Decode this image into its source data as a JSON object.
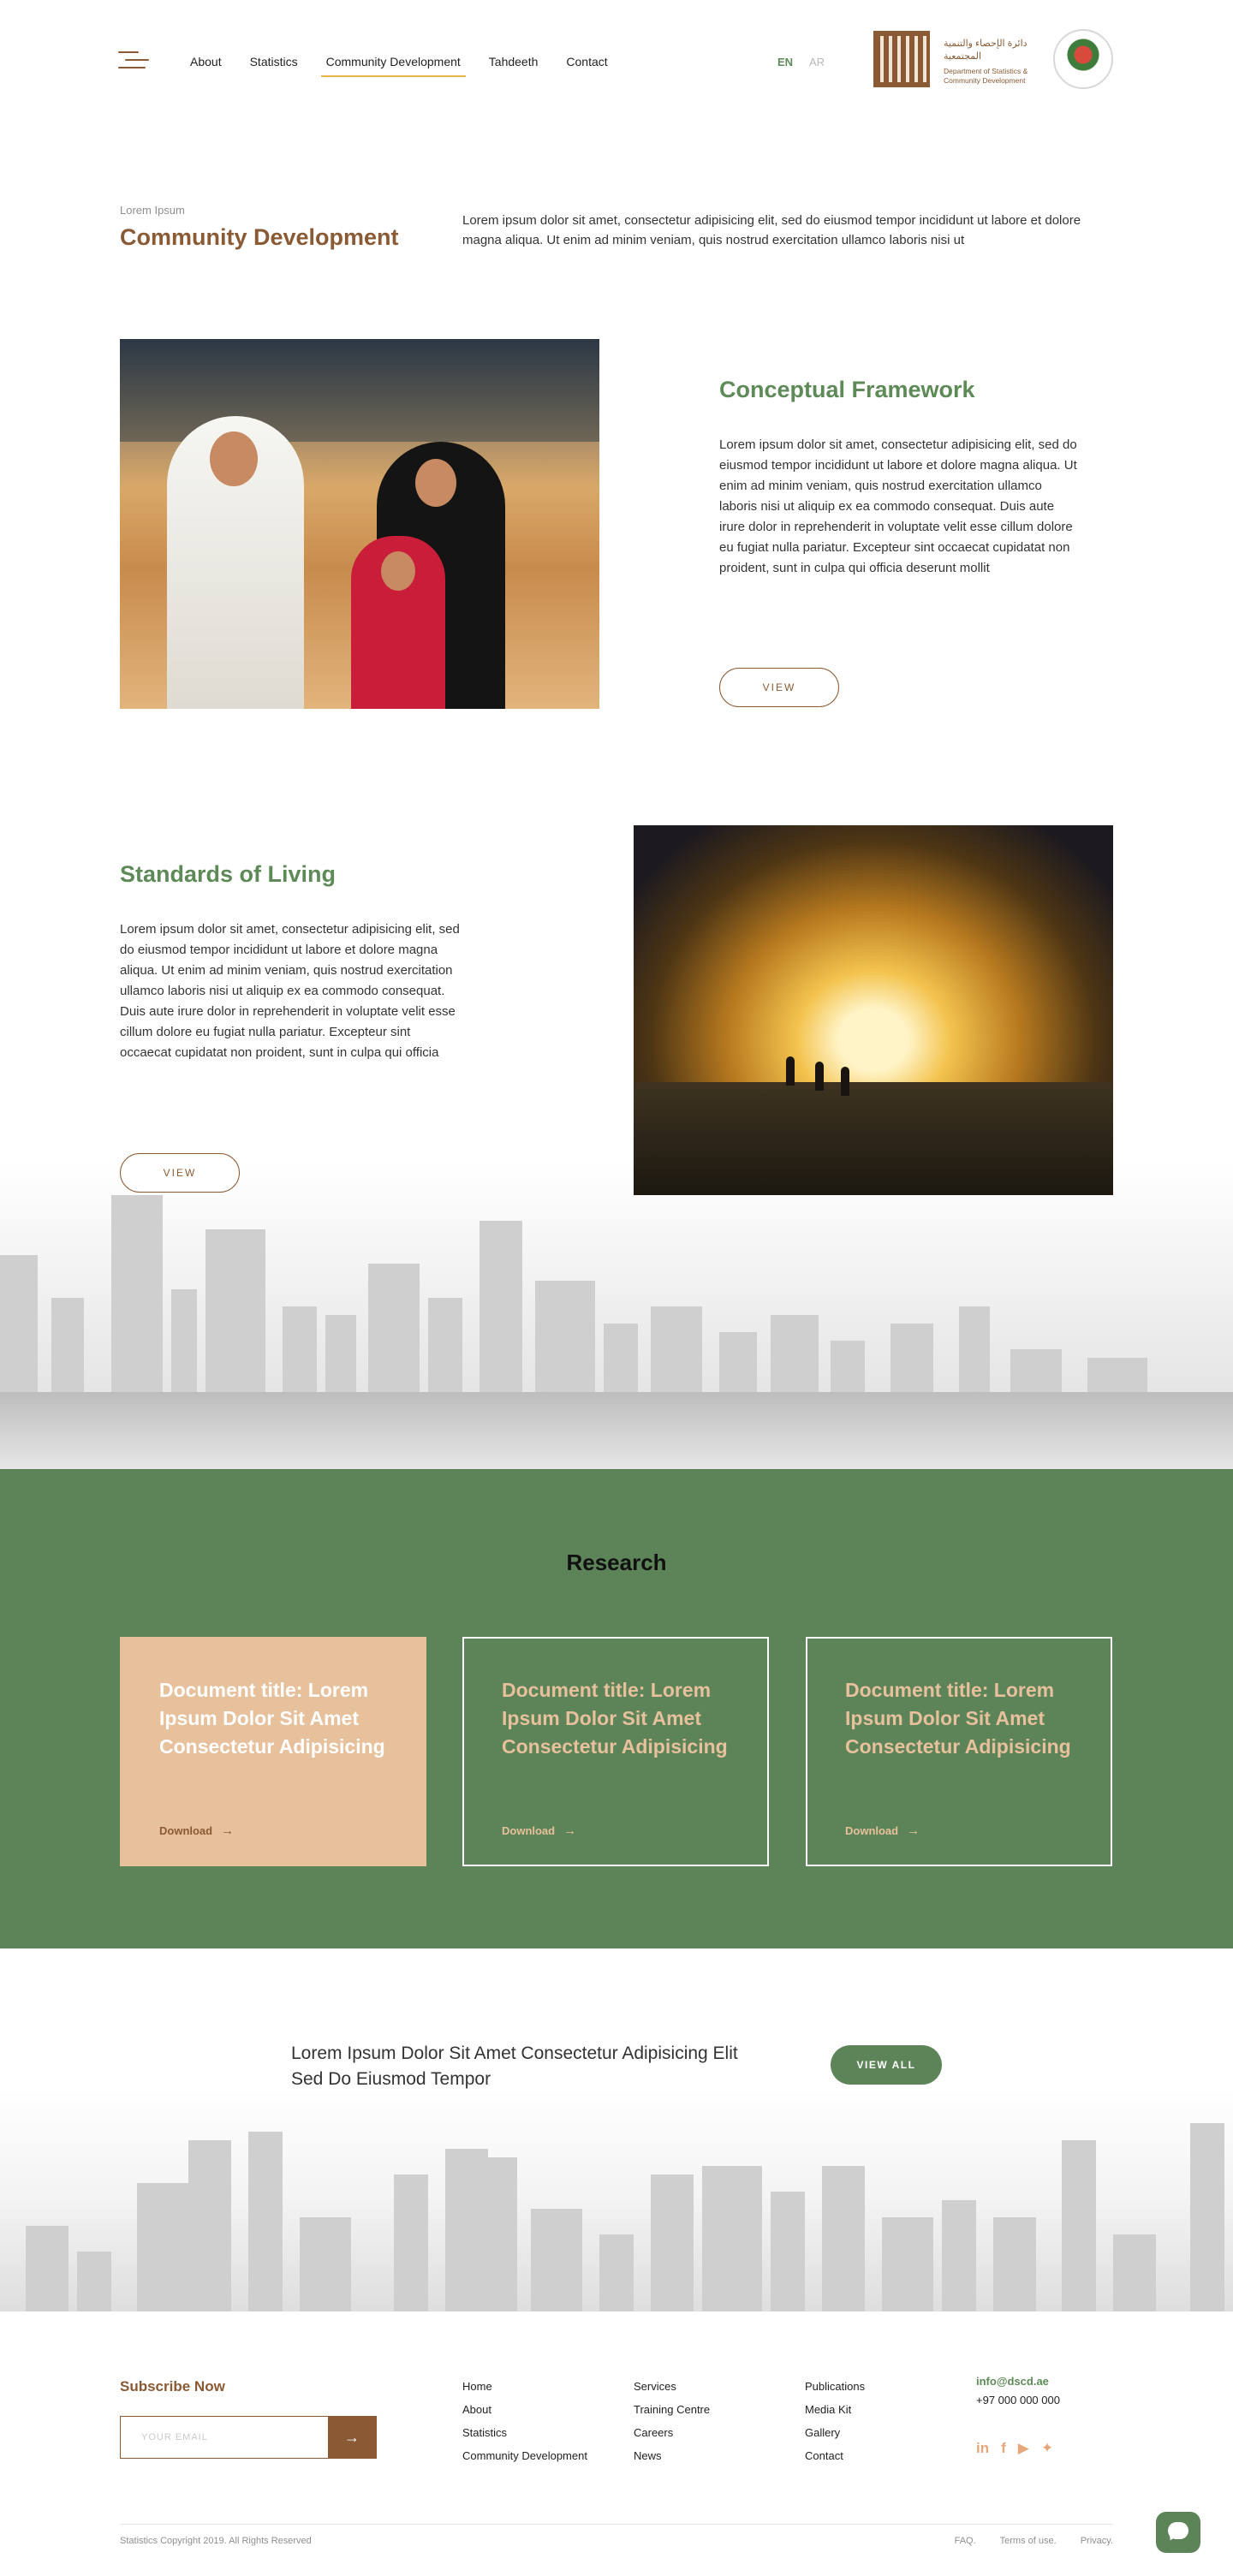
{
  "header": {
    "nav": [
      "About",
      "Statistics",
      "Community Development",
      "Tahdeeth",
      "Contact"
    ],
    "active_index": 2,
    "lang_en": "EN",
    "lang_ar": "AR",
    "brand_arabic": "دائرة الإحصاء والتنمية المجتمعية",
    "brand_english": "Department of Statistics & Community Development"
  },
  "intro": {
    "eyebrow": "Lorem Ipsum",
    "title": "Community Development",
    "text": "Lorem ipsum dolor sit amet, consectetur adipisicing elit, sed do eiusmod tempor incididunt ut labore et dolore magna aliqua. Ut enim ad minim veniam, quis nostrud exercitation ullamco laboris nisi ut"
  },
  "features": [
    {
      "title": "Conceptual Framework",
      "text": "Lorem ipsum dolor sit amet, consectetur adipisicing elit, sed do eiusmod tempor incididunt ut labore et dolore magna aliqua. Ut enim ad minim veniam, quis nostrud exercitation ullamco laboris nisi ut aliquip ex ea commodo consequat. Duis aute irure dolor in reprehenderit in voluptate velit esse cillum dolore eu fugiat nulla pariatur. Excepteur sint occaecat cupidatat non proident, sunt in culpa qui officia deserunt mollit",
      "button": "VIEW"
    },
    {
      "title": "Standards of Living",
      "text": "Lorem ipsum dolor sit amet, consectetur adipisicing elit, sed do eiusmod tempor incididunt ut labore et dolore magna aliqua. Ut enim ad minim veniam, quis nostrud exercitation ullamco laboris nisi ut aliquip ex ea commodo consequat. Duis aute irure dolor in reprehenderit in voluptate velit esse cillum dolore eu fugiat nulla pariatur. Excepteur sint occaecat cupidatat non proident, sunt in culpa qui officia",
      "button": "VIEW"
    }
  ],
  "research": {
    "title": "Research",
    "cards": [
      {
        "title": "Document title: Lorem Ipsum Dolor Sit Amet Consectetur Adipisicing",
        "action": "Download"
      },
      {
        "title": "Document title: Lorem Ipsum Dolor Sit Amet Consectetur Adipisicing",
        "action": "Download"
      },
      {
        "title": "Document title: Lorem Ipsum Dolor Sit Amet Consectetur Adipisicing",
        "action": "Download"
      }
    ]
  },
  "cta": {
    "text": "Lorem Ipsum Dolor Sit Amet Consectetur Adipisicing Elit Sed Do Eiusmod Tempor",
    "button": "VIEW ALL"
  },
  "footer": {
    "subscribe_title": "Subscribe Now",
    "email_placeholder": "YOUR EMAIL",
    "columns": [
      [
        "Home",
        "About",
        "Statistics",
        "Community Development"
      ],
      [
        "Services",
        "Training Centre",
        "Careers",
        "News"
      ],
      [
        "Publications",
        "Media Kit",
        "Gallery",
        "Contact"
      ]
    ],
    "email": "info@dscd.ae",
    "phone": "+97 000 000 000",
    "socials": [
      "linkedin-icon",
      "facebook-icon",
      "youtube-icon",
      "twitter-icon"
    ],
    "copyright": "Statistics Copyright 2019. All Rights Reserved",
    "legal": [
      "FAQ.",
      "Terms of use.",
      "Privacy."
    ]
  },
  "colors": {
    "brown": "#8a5a34",
    "green": "#5d8459",
    "peach": "#e7c09c",
    "nav_active": "#e8b64a"
  }
}
